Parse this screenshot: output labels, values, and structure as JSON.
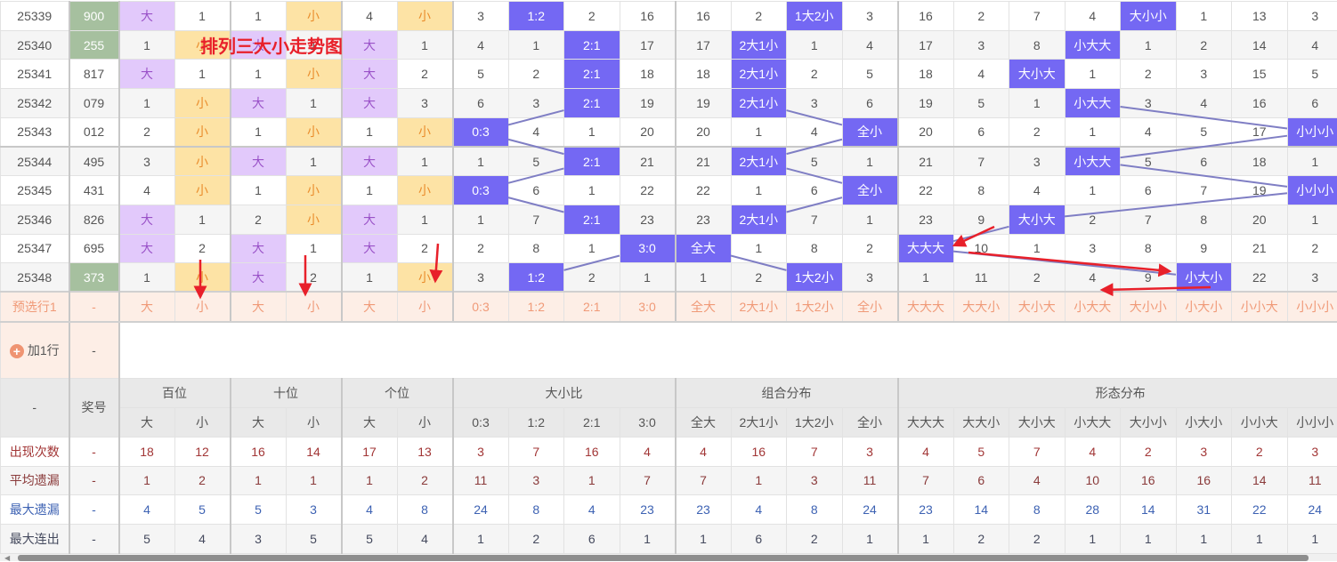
{
  "title_annotation": "排列三大小走势图",
  "colors": {
    "hit": "#7468f3",
    "big_bg": "#e2c9fb",
    "small_bg": "#fde3a5",
    "number_hl": "#a6c09f",
    "trend_line": "#7f7ec4",
    "annotation": "#e8202a"
  },
  "header": {
    "corner": "-",
    "number": "奖号",
    "groups": [
      {
        "label": "百位",
        "cols": [
          "大",
          "小"
        ]
      },
      {
        "label": "十位",
        "cols": [
          "大",
          "小"
        ]
      },
      {
        "label": "个位",
        "cols": [
          "大",
          "小"
        ]
      },
      {
        "label": "大小比",
        "cols": [
          "0:3",
          "1:2",
          "2:1",
          "3:0"
        ]
      },
      {
        "label": "组合分布",
        "cols": [
          "全大",
          "2大1小",
          "1大2小",
          "全小"
        ]
      },
      {
        "label": "形态分布",
        "cols": [
          "大大大",
          "大大小",
          "大小大",
          "小大大",
          "大小小",
          "小大小",
          "小小大",
          "小小小"
        ]
      }
    ]
  },
  "rows": [
    {
      "issue": "25339",
      "number": "900",
      "number_highlight": true,
      "cells": [
        "大",
        "1",
        "1",
        "小",
        "4",
        "小",
        "3",
        "1:2",
        "2",
        "16",
        "16",
        "2",
        "1大2小",
        "3",
        "16",
        "2",
        "7",
        "4",
        "大小小",
        "1",
        "13",
        "3"
      ]
    },
    {
      "issue": "25340",
      "number": "255",
      "number_highlight": true,
      "cells": [
        "1",
        "小",
        "大",
        "1",
        "大",
        "1",
        "4",
        "1",
        "2:1",
        "17",
        "17",
        "2大1小",
        "1",
        "4",
        "17",
        "3",
        "8",
        "小大大",
        "1",
        "2",
        "14",
        "4"
      ]
    },
    {
      "issue": "25341",
      "number": "817",
      "number_highlight": false,
      "cells": [
        "大",
        "1",
        "1",
        "小",
        "大",
        "2",
        "5",
        "2",
        "2:1",
        "18",
        "18",
        "2大1小",
        "2",
        "5",
        "18",
        "4",
        "大小大",
        "1",
        "2",
        "3",
        "15",
        "5"
      ]
    },
    {
      "issue": "25342",
      "number": "079",
      "number_highlight": false,
      "cells": [
        "1",
        "小",
        "大",
        "1",
        "大",
        "3",
        "6",
        "3",
        "2:1",
        "19",
        "19",
        "2大1小",
        "3",
        "6",
        "19",
        "5",
        "1",
        "小大大",
        "3",
        "4",
        "16",
        "6"
      ]
    },
    {
      "issue": "25343",
      "number": "012",
      "number_highlight": false,
      "cells": [
        "2",
        "小",
        "1",
        "小",
        "1",
        "小",
        "0:3",
        "4",
        "1",
        "20",
        "20",
        "1",
        "4",
        "全小",
        "20",
        "6",
        "2",
        "1",
        "4",
        "5",
        "17",
        "小小小"
      ]
    },
    {
      "issue": "25344",
      "number": "495",
      "number_highlight": false,
      "cells": [
        "3",
        "小",
        "大",
        "1",
        "大",
        "1",
        "1",
        "5",
        "2:1",
        "21",
        "21",
        "2大1小",
        "5",
        "1",
        "21",
        "7",
        "3",
        "小大大",
        "5",
        "6",
        "18",
        "1"
      ]
    },
    {
      "issue": "25345",
      "number": "431",
      "number_highlight": false,
      "cells": [
        "4",
        "小",
        "1",
        "小",
        "1",
        "小",
        "0:3",
        "6",
        "1",
        "22",
        "22",
        "1",
        "6",
        "全小",
        "22",
        "8",
        "4",
        "1",
        "6",
        "7",
        "19",
        "小小小"
      ]
    },
    {
      "issue": "25346",
      "number": "826",
      "number_highlight": false,
      "cells": [
        "大",
        "1",
        "2",
        "小",
        "大",
        "1",
        "1",
        "7",
        "2:1",
        "23",
        "23",
        "2大1小",
        "7",
        "1",
        "23",
        "9",
        "大小大",
        "2",
        "7",
        "8",
        "20",
        "1"
      ]
    },
    {
      "issue": "25347",
      "number": "695",
      "number_highlight": false,
      "cells": [
        "大",
        "2",
        "大",
        "1",
        "大",
        "2",
        "2",
        "8",
        "1",
        "3:0",
        "全大",
        "1",
        "8",
        "2",
        "大大大",
        "10",
        "1",
        "3",
        "8",
        "9",
        "21",
        "2"
      ]
    },
    {
      "issue": "25348",
      "number": "373",
      "number_highlight": true,
      "cells": [
        "1",
        "小",
        "大",
        "2",
        "1",
        "小",
        "3",
        "1:2",
        "2",
        "1",
        "1",
        "2",
        "1大2小",
        "3",
        "1",
        "11",
        "2",
        "4",
        "9",
        "小大小",
        "22",
        "3"
      ]
    }
  ],
  "preselect": {
    "label": "预选行1",
    "number": "-",
    "cells": [
      "大",
      "小",
      "大",
      "小",
      "大",
      "小",
      "0:3",
      "1:2",
      "2:1",
      "3:0",
      "全大",
      "2大1小",
      "1大2小",
      "全小",
      "大大大",
      "大大小",
      "大小大",
      "小大大",
      "大小小",
      "小大小",
      "小小大",
      "小小小"
    ]
  },
  "add_row": {
    "label": "加1行",
    "number": "-"
  },
  "stats": [
    {
      "label": "出现次数",
      "number": "-",
      "color": "#a23636",
      "values": [
        "18",
        "12",
        "16",
        "14",
        "17",
        "13",
        "3",
        "7",
        "16",
        "4",
        "4",
        "16",
        "7",
        "3",
        "4",
        "5",
        "7",
        "4",
        "2",
        "3",
        "2",
        "3"
      ]
    },
    {
      "label": "平均遗漏",
      "number": "-",
      "color": "#8a3a3a",
      "values": [
        "1",
        "2",
        "1",
        "1",
        "1",
        "2",
        "11",
        "3",
        "1",
        "7",
        "7",
        "1",
        "3",
        "11",
        "7",
        "6",
        "4",
        "10",
        "16",
        "16",
        "14",
        "11"
      ]
    },
    {
      "label": "最大遗漏",
      "number": "-",
      "color": "#3d62b3",
      "values": [
        "4",
        "5",
        "5",
        "3",
        "4",
        "8",
        "24",
        "8",
        "4",
        "23",
        "23",
        "4",
        "8",
        "24",
        "23",
        "14",
        "8",
        "28",
        "14",
        "31",
        "22",
        "24"
      ]
    },
    {
      "label": "最大连出",
      "number": "-",
      "color": "#454a5e",
      "values": [
        "5",
        "4",
        "3",
        "5",
        "5",
        "4",
        "1",
        "2",
        "6",
        "1",
        "1",
        "6",
        "2",
        "1",
        "1",
        "2",
        "2",
        "1",
        "1",
        "1",
        "1",
        "1"
      ]
    }
  ]
}
